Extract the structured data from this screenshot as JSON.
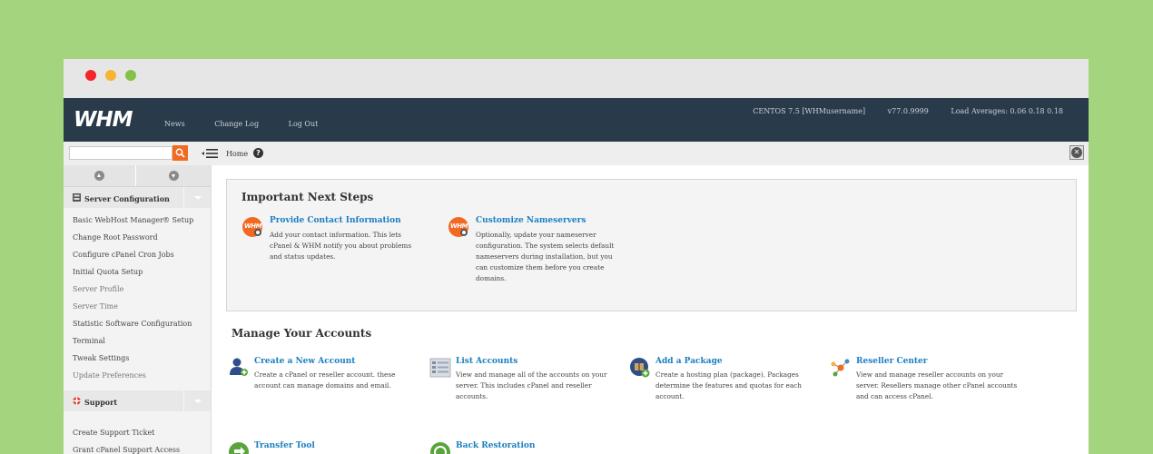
{
  "window": {
    "controls": [
      "close",
      "minimize",
      "maximize"
    ]
  },
  "topbar": {
    "logo": "WHM",
    "nav": [
      "News",
      "Change Log",
      "Log Out"
    ],
    "os": "CENTOS 7.5 [WHMusername]",
    "version": "v77.0.9999",
    "load": "Load Averages: 0.06 0.18 0.18"
  },
  "toolbar": {
    "search_value": "",
    "breadcrumb": "Home",
    "help": "?"
  },
  "sidebar": {
    "server_config": {
      "label": "Server Configuration",
      "items": [
        {
          "label": "Basic WebHost Manager",
          "tag": "® Setup"
        },
        {
          "label": "Change Root Password"
        },
        {
          "label": "Configure cPanel Cron Jobs"
        },
        {
          "label": "Initial Quota Setup"
        },
        {
          "label": "Server Profile"
        },
        {
          "label": "Server Time"
        },
        {
          "label": "Statistic Software Configuration"
        },
        {
          "label": "Terminal"
        },
        {
          "label": "Tweak Settings"
        },
        {
          "label": "Update Preferences"
        }
      ]
    },
    "support": {
      "label": "Support",
      "items": [
        {
          "label": "Create Support Ticket"
        },
        {
          "label": "Grant cPanel Support Access"
        }
      ]
    }
  },
  "next_steps": {
    "title": "Important Next Steps",
    "items": [
      {
        "title": "Provide Contact Information",
        "desc": "Add your contact information. This lets cPanel & WHM notify you about problems and status updates.",
        "icon": "whm-gear-icon"
      },
      {
        "title": "Customize Nameservers",
        "desc": "Optionally, update your nameserver configuration. The system selects default nameservers during installation, but you can customize them before you create domains.",
        "icon": "whm-gear-icon"
      }
    ]
  },
  "accounts": {
    "title": "Manage Your Accounts",
    "items": [
      {
        "title": "Create a New Account",
        "desc": "Create a cPanel or reseller account. these account can manage domains and email.",
        "icon": "add-user-icon"
      },
      {
        "title": "List Accounts",
        "desc": "View and manage all of the accounts on your server. This includes cPanel and reseller accounts.",
        "icon": "list-accounts-icon"
      },
      {
        "title": "Add a Package",
        "desc": "Create a hosting plan (package). Packages determine the features and quotas for each account.",
        "icon": "package-icon"
      },
      {
        "title": "Reseller Center",
        "desc": "View and manage reseller accounts on your server. Resellers manage other cPanel accounts and can access cPanel.",
        "icon": "reseller-icon"
      },
      {
        "title": "Transfer Tool",
        "desc": "",
        "icon": "transfer-icon"
      },
      {
        "title": "Back Restoration",
        "desc": "",
        "icon": "restore-icon"
      }
    ]
  },
  "colors": {
    "background": "#a5d47f",
    "topbar": "#293a4a",
    "accent": "#f26a21",
    "link": "#1a7fc1"
  }
}
